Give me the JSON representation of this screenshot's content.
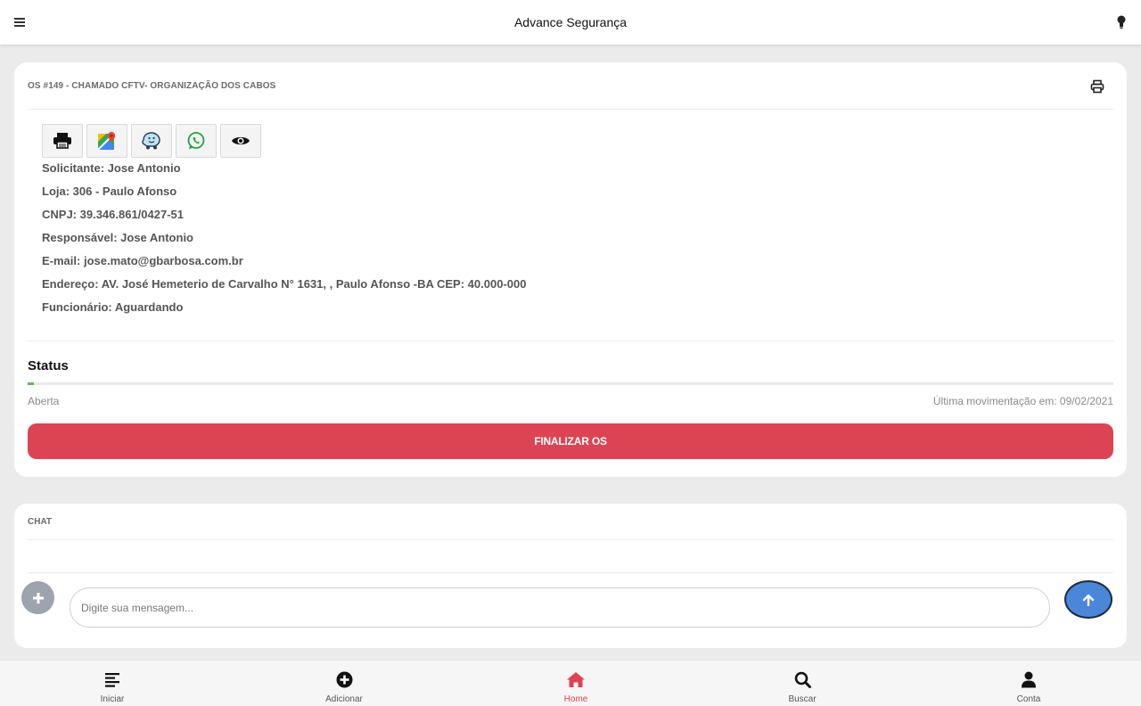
{
  "app": {
    "title": "Advance Segurança"
  },
  "os_card": {
    "title": "OS #149 - CHAMADO CFTV- ORGANIZAÇÃO DOS CABOS",
    "action_buttons": [
      {
        "icon": "printer-icon"
      },
      {
        "icon": "google-maps-icon"
      },
      {
        "icon": "waze-icon"
      },
      {
        "icon": "whatsapp-icon"
      },
      {
        "icon": "eye-icon"
      }
    ],
    "info": {
      "solicitante": "Solicitante: Jose Antonio",
      "loja": "Loja: 306 - Paulo Afonso",
      "cnpj": "CNPJ: 39.346.861/0427-51",
      "responsavel": "Responsável: Jose Antonio",
      "email": "E-mail: jose.mato@gbarbosa.com.br",
      "endereco": "Endereço: AV. José Hemeterio de Carvalho N° 1631, , Paulo Afonso -BA CEP: 40.000-000",
      "funcionario": "Funcionário: Aguardando"
    },
    "status": {
      "heading": "Status",
      "value": "Aberta",
      "progress_percent": 0.6,
      "last_movement": "Última movimentação em: 09/02/2021"
    },
    "finalize_label": "FINALIZAR OS"
  },
  "chat": {
    "title": "CHAT",
    "input_placeholder": "Digite sua mensagem..."
  },
  "bottom_nav": {
    "items": [
      {
        "label": "Iniciar",
        "icon": "list-icon"
      },
      {
        "label": "Adicionar",
        "icon": "plus-circle-icon"
      },
      {
        "label": "Home",
        "icon": "home-icon",
        "active": true
      },
      {
        "label": "Buscar",
        "icon": "search-icon"
      },
      {
        "label": "Conta",
        "icon": "user-icon"
      }
    ]
  },
  "colors": {
    "accent_red": "#dc4453",
    "progress_green": "#5cb85c",
    "send_blue": "#4a87d8"
  }
}
